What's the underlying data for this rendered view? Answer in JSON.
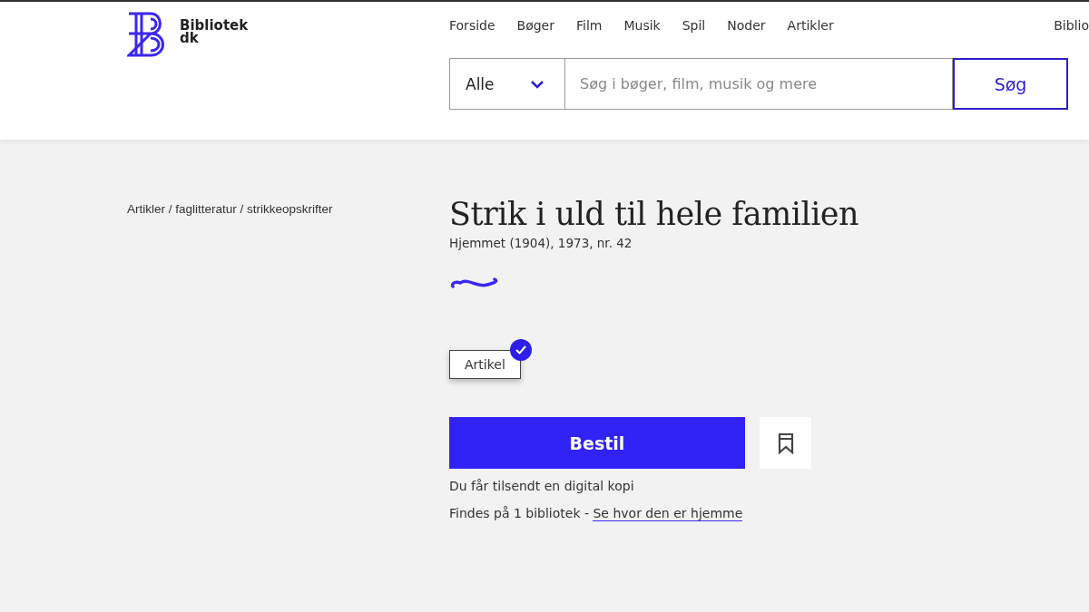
{
  "logo": {
    "line1": "Bibliotek",
    "line2": "dk"
  },
  "nav": [
    {
      "label": "Forside"
    },
    {
      "label": "Bøger"
    },
    {
      "label": "Film"
    },
    {
      "label": "Musik"
    },
    {
      "label": "Spil"
    },
    {
      "label": "Noder"
    },
    {
      "label": "Artikler"
    }
  ],
  "nav_cut": "Biblio",
  "search": {
    "category": "Alle",
    "placeholder": "Søg i bøger, film, musik og mere",
    "button": "Søg"
  },
  "breadcrumb": "Artikler / faglitteratur / strikkeopskrifter",
  "title": "Strik i uld til hele familien",
  "subtitle": "Hjemmet (1904), 1973, nr. 42",
  "formats": [
    {
      "label": "Artikel",
      "selected": true
    }
  ],
  "order_button": "Bestil",
  "delivery_note": "Du får tilsendt en digital kopi",
  "availability": {
    "text": "Findes på 1 bibliotek - ",
    "link": "Se hvor den er hjemme"
  }
}
